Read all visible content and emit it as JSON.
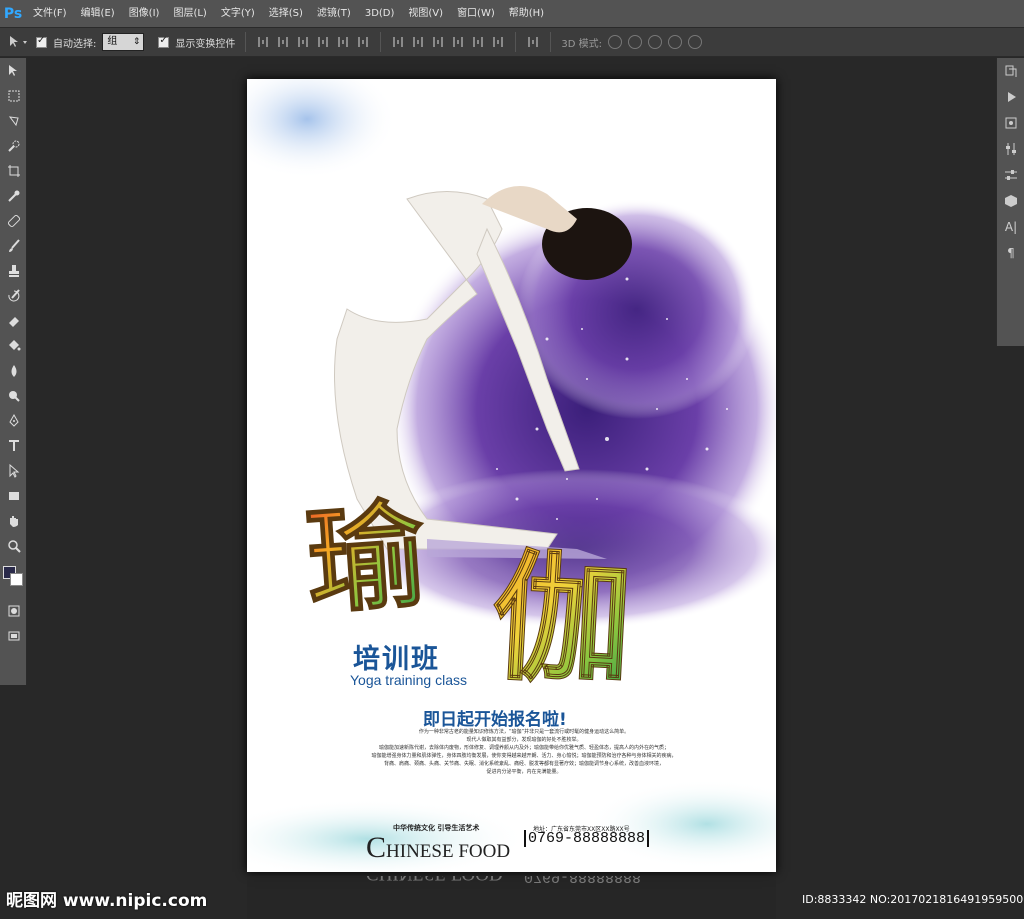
{
  "app": {
    "logo": "Ps"
  },
  "menu": [
    {
      "label": "文件(F)"
    },
    {
      "label": "编辑(E)"
    },
    {
      "label": "图像(I)"
    },
    {
      "label": "图层(L)"
    },
    {
      "label": "文字(Y)"
    },
    {
      "label": "选择(S)"
    },
    {
      "label": "滤镜(T)"
    },
    {
      "label": "3D(D)"
    },
    {
      "label": "视图(V)"
    },
    {
      "label": "窗口(W)"
    },
    {
      "label": "帮助(H)"
    }
  ],
  "options": {
    "auto_select_label": "自动选择:",
    "auto_select_value": "组",
    "show_transform_label": "显示变换控件",
    "mode_3d_label": "3D 模式:"
  },
  "poster": {
    "calligraphy": "瑜伽",
    "title_cn": "培训班",
    "title_en": "Yoga training class",
    "slogan": "即日起开始报名啦!",
    "body": [
      "作为一种非常古老的能量知识修炼方法，“瑜伽”并非只是一套流行或时髦的健身运动这么简单。",
      "现代人做取其有益部分，发现瑜伽的好处不胜枚举。",
      "瑜伽能加速新陈代谢，去除体内废物，形体修复、调理养颜从内及外；瑜伽能带给你优雅气质、轻盈体态，提高人的内外在的气质；",
      "瑜伽能增强身体力量和肌体弹性，身体四肢均衡发展，使你变得越来越开朗、活力、身心愉悦；瑜伽能预防和治疗各种与身体相关的疾病，",
      "背痛、肩痛、颈痛、头痛、关节痛、失眠、消化系统紊乱、痛经、脱发等都有显著疗效；瑜伽能调节身心系统，改善血液环境，",
      "促进内分泌平衡，内在充满能量。"
    ],
    "footer_slogan": "中华传统文化 引导生活艺术",
    "footer_en_initial": "C",
    "footer_en_rest": "HINESE FOOD",
    "address": "地址：广东省东莞市XX区XX路XX号",
    "phone": "0769-88888888"
  },
  "watermark": {
    "left": "昵图网 www.nipic.com",
    "right": "ID:8833342 NO:20170218164919595000"
  },
  "colors": {
    "ui_bg": "#282828",
    "menubar": "#535353",
    "accent_blue": "#1a5598",
    "splash_purple": "#6a3fa8"
  }
}
